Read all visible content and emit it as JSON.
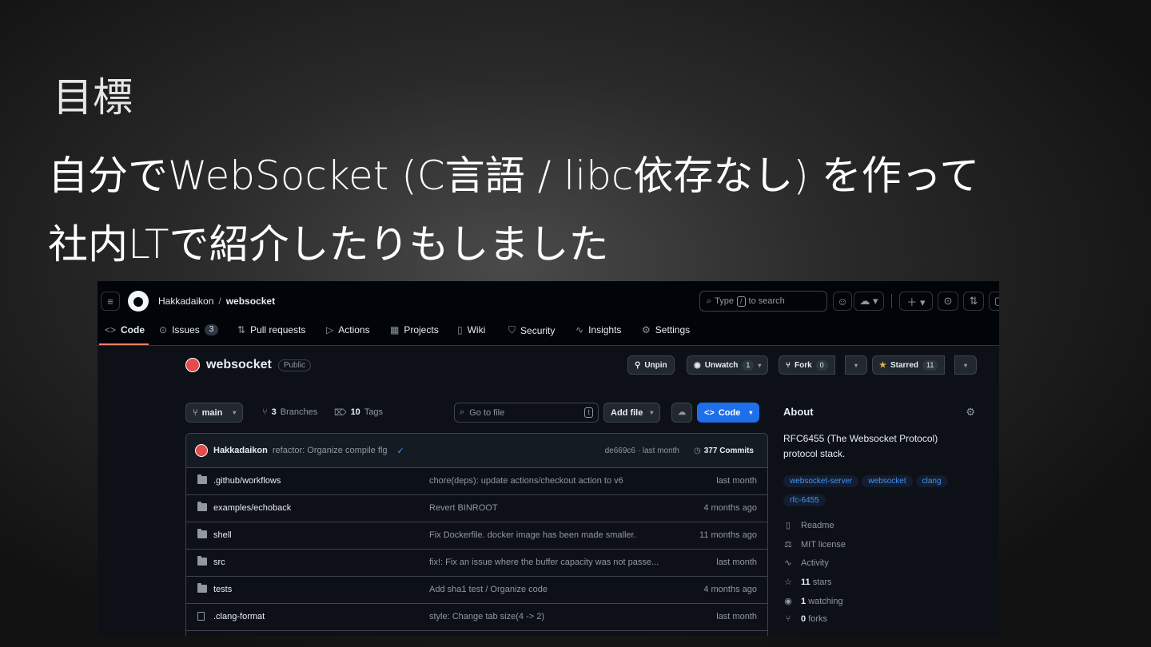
{
  "slide": {
    "title": "目標",
    "line1": "自分でWebSocket (C言語 / libc依存なし) を作って",
    "line2": "社内LTで紹介したりもしました"
  },
  "header": {
    "owner": "Hakkadaikon",
    "separator": "/",
    "repo": "websocket",
    "search_prefix": "Type",
    "search_key": "/",
    "search_suffix": "to search"
  },
  "tabs": [
    {
      "label": "Code",
      "icon": "code-icon"
    },
    {
      "label": "Issues",
      "icon": "issue-icon",
      "count": "3"
    },
    {
      "label": "Pull requests",
      "icon": "pull-request-icon"
    },
    {
      "label": "Actions",
      "icon": "play-icon"
    },
    {
      "label": "Projects",
      "icon": "table-icon"
    },
    {
      "label": "Wiki",
      "icon": "book-icon"
    },
    {
      "label": "Security",
      "icon": "shield-icon"
    },
    {
      "label": "Insights",
      "icon": "graph-icon"
    },
    {
      "label": "Settings",
      "icon": "gear-icon"
    }
  ],
  "repo_header": {
    "name": "websocket",
    "visibility": "Public",
    "unpin": "Unpin",
    "unwatch": "Unwatch",
    "unwatch_count": "1",
    "fork": "Fork",
    "fork_count": "0",
    "starred": "Starred",
    "star_count": "11"
  },
  "branch_bar": {
    "branch": "main",
    "branches_count": "3",
    "branches_label": "Branches",
    "tags_count": "10",
    "tags_label": "Tags",
    "go_to_file": "Go to file",
    "go_to_file_key": "t",
    "add_file": "Add file",
    "code": "Code"
  },
  "latest_commit": {
    "author": "Hakkadaikon",
    "message": "refactor: Organize compile flg",
    "hash_time": "de669c6 · last month",
    "commits": "377 Commits"
  },
  "files": [
    {
      "name": ".github/workflows",
      "type": "folder",
      "message": "chore(deps): update actions/checkout action to v6",
      "date": "last month"
    },
    {
      "name": "examples/echoback",
      "type": "folder",
      "message": "Revert BINROOT",
      "date": "4 months ago"
    },
    {
      "name": "shell",
      "type": "folder",
      "message": "Fix Dockerfile. docker image has been made smaller.",
      "date": "11 months ago"
    },
    {
      "name": "src",
      "type": "folder",
      "message": "fix!: Fix an issue where the buffer capacity was not passe...",
      "date": "last month"
    },
    {
      "name": "tests",
      "type": "folder",
      "message": "Add sha1 test / Organize code",
      "date": "4 months ago"
    },
    {
      "name": ".clang-format",
      "type": "file",
      "message": "style: Change tab size(4 -> 2)",
      "date": "last month"
    }
  ],
  "about": {
    "title": "About",
    "description": "RFC6455 (The Websocket Protocol) protocol stack.",
    "topics": [
      "websocket-server",
      "websocket",
      "clang",
      "rfc-6455"
    ],
    "readme": "Readme",
    "license": "MIT license",
    "activity": "Activity",
    "stars_count": "11",
    "stars_label": "stars",
    "watching_count": "1",
    "watching_label": "watching",
    "forks_count": "0",
    "forks_label": "forks"
  },
  "colors": {
    "accent_blue": "#1f6feb",
    "tab_underline": "#f78166",
    "star_yellow": "#e3b341",
    "background": "#0d1117"
  }
}
